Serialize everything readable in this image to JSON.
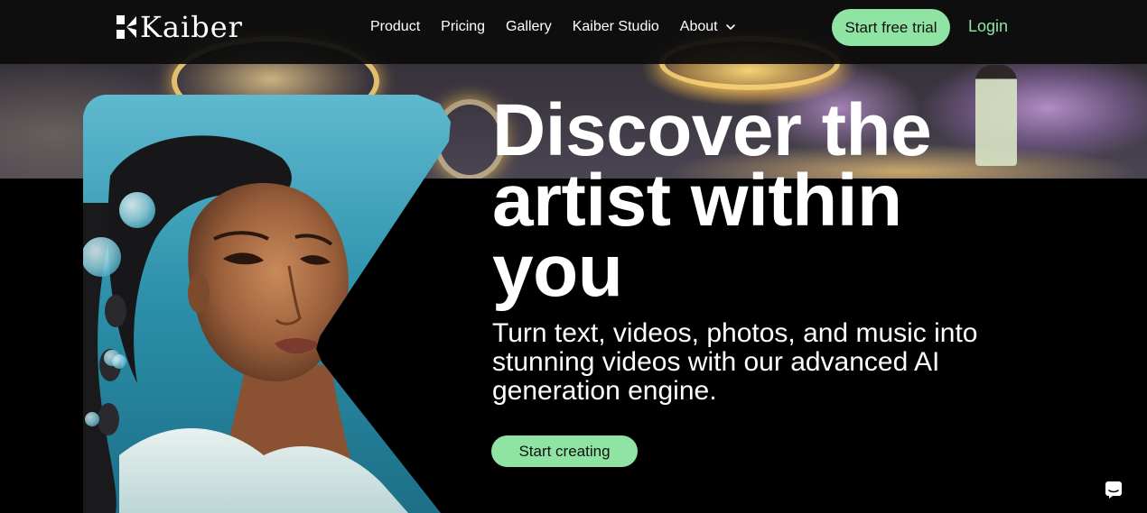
{
  "brand": {
    "name": "Kaiber"
  },
  "nav": {
    "links": [
      {
        "label": "Product"
      },
      {
        "label": "Pricing"
      },
      {
        "label": "Gallery"
      },
      {
        "label": "Kaiber Studio"
      }
    ],
    "about_label": "About",
    "cta_label": "Start free trial",
    "login_label": "Login"
  },
  "hero": {
    "headline": "Discover the artist within you",
    "subheadline": "Turn text, videos, photos, and music into stunning videos with our advanced AI generation engine.",
    "cta_label": "Start creating"
  },
  "icons": {
    "logo": "kaiber-logo-icon",
    "about_dropdown": "chevron-down-icon",
    "chat": "chat-bubble-icon"
  },
  "colors": {
    "accent": "#8fe4a3",
    "background": "#000000",
    "nav_background": "#0c0c0c"
  }
}
